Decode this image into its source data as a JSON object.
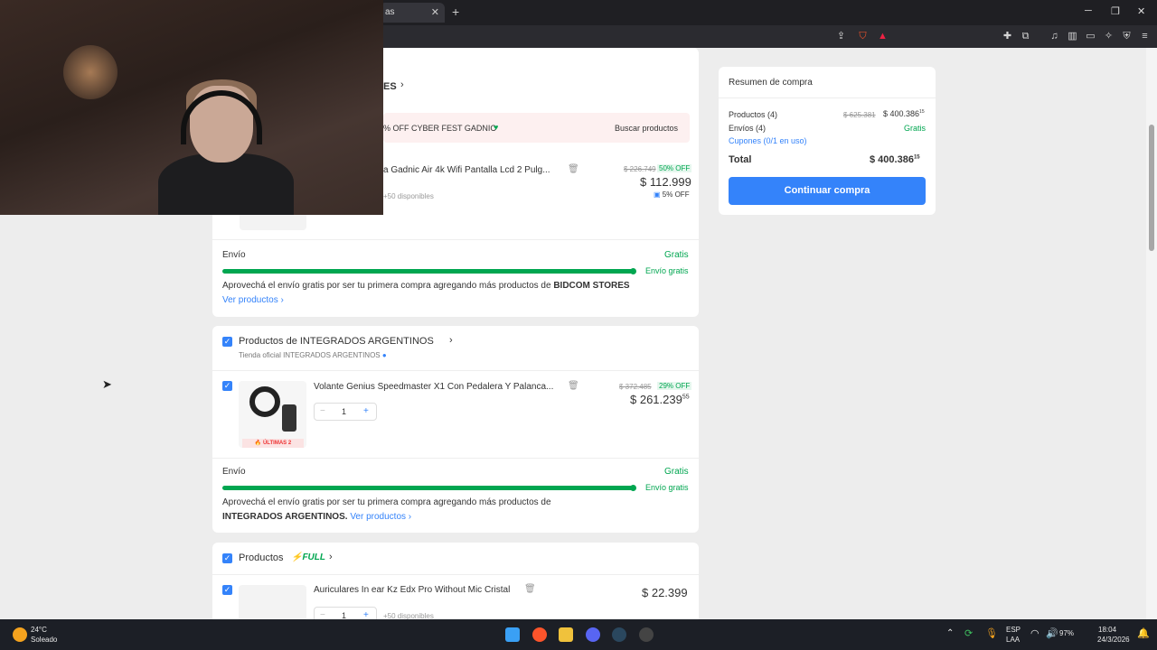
{
  "browser": {
    "tab_title": "as",
    "tab_close": "✕",
    "new_tab": "+",
    "minimize": "─",
    "maximize": "❐",
    "close": "✕"
  },
  "page": {
    "seller1_heading": "ES",
    "promo_text": "% OFF CYBER FEST GADNIC",
    "promo_link": "Buscar productos",
    "item1": {
      "title": "a Gadnic Air 4k Wifi Pantalla Lcd 2 Pulg...",
      "old_price": "$ 226.749",
      "discount": "50% OFF",
      "price": "$ 112.999",
      "stock": "+50 disponibles",
      "badge": "5% OFF"
    },
    "shipping1": {
      "label": "Envío",
      "value": "Gratis",
      "bar_label": "Envío gratis",
      "progress": 100,
      "message_prefix": "Aprovechá el envío gratis por ser tu primera compra agregando más productos de",
      "seller": "BIDCOM STORES",
      "link": "Ver productos ›"
    },
    "seller2": {
      "heading": "Productos de INTEGRADOS ARGENTINOS",
      "subtitle": "Tienda oficial INTEGRADOS ARGENTINOS"
    },
    "item2": {
      "title": "Volante Genius Speedmaster X1 Con Pedalera Y Palanca...",
      "old_price": "$ 372.485",
      "discount": "29% OFF",
      "price": "$ 261.239",
      "price_cents": "55",
      "qty": "1",
      "minus": "−",
      "plus": "+",
      "tag": "🔥 ÚLTIMAS 2"
    },
    "shipping2": {
      "label": "Envío",
      "value": "Gratis",
      "bar_label": "Envío gratis",
      "progress": 100,
      "message_prefix": "Aprovechá el envío gratis por ser tu primera compra agregando más productos de",
      "seller": "INTEGRADOS ARGENTINOS.",
      "link": "Ver productos ›"
    },
    "seller3": {
      "heading": "Productos",
      "full": "FULL"
    },
    "item3": {
      "title": "Auriculares In ear Kz Edx Pro Without Mic Cristal",
      "price": "$ 22.399",
      "qty": "1",
      "minus": "−",
      "plus": "+",
      "stock": "+50 disponibles"
    }
  },
  "summary": {
    "title": "Resumen de compra",
    "products_label": "Productos (4)",
    "products_old": "$ 625.381",
    "products_value": "$ 400.386",
    "products_cents": "15",
    "shipping_label": "Envíos (4)",
    "shipping_value": "Gratis",
    "coupons_link": "Cupones (0/1 en uso)",
    "total_label": "Total",
    "total_value": "$ 400.386",
    "total_cents": "15",
    "continue_button": "Continuar compra"
  },
  "taskbar": {
    "temp": "24°C",
    "weather": "Soleado",
    "lang1": "ESP",
    "lang2": "LAA",
    "battery": "97%",
    "time": "18:04",
    "date": "24/3/2026"
  },
  "colors": {
    "accent": "#3483fa",
    "success": "#00a650",
    "page_bg": "#ededed"
  }
}
